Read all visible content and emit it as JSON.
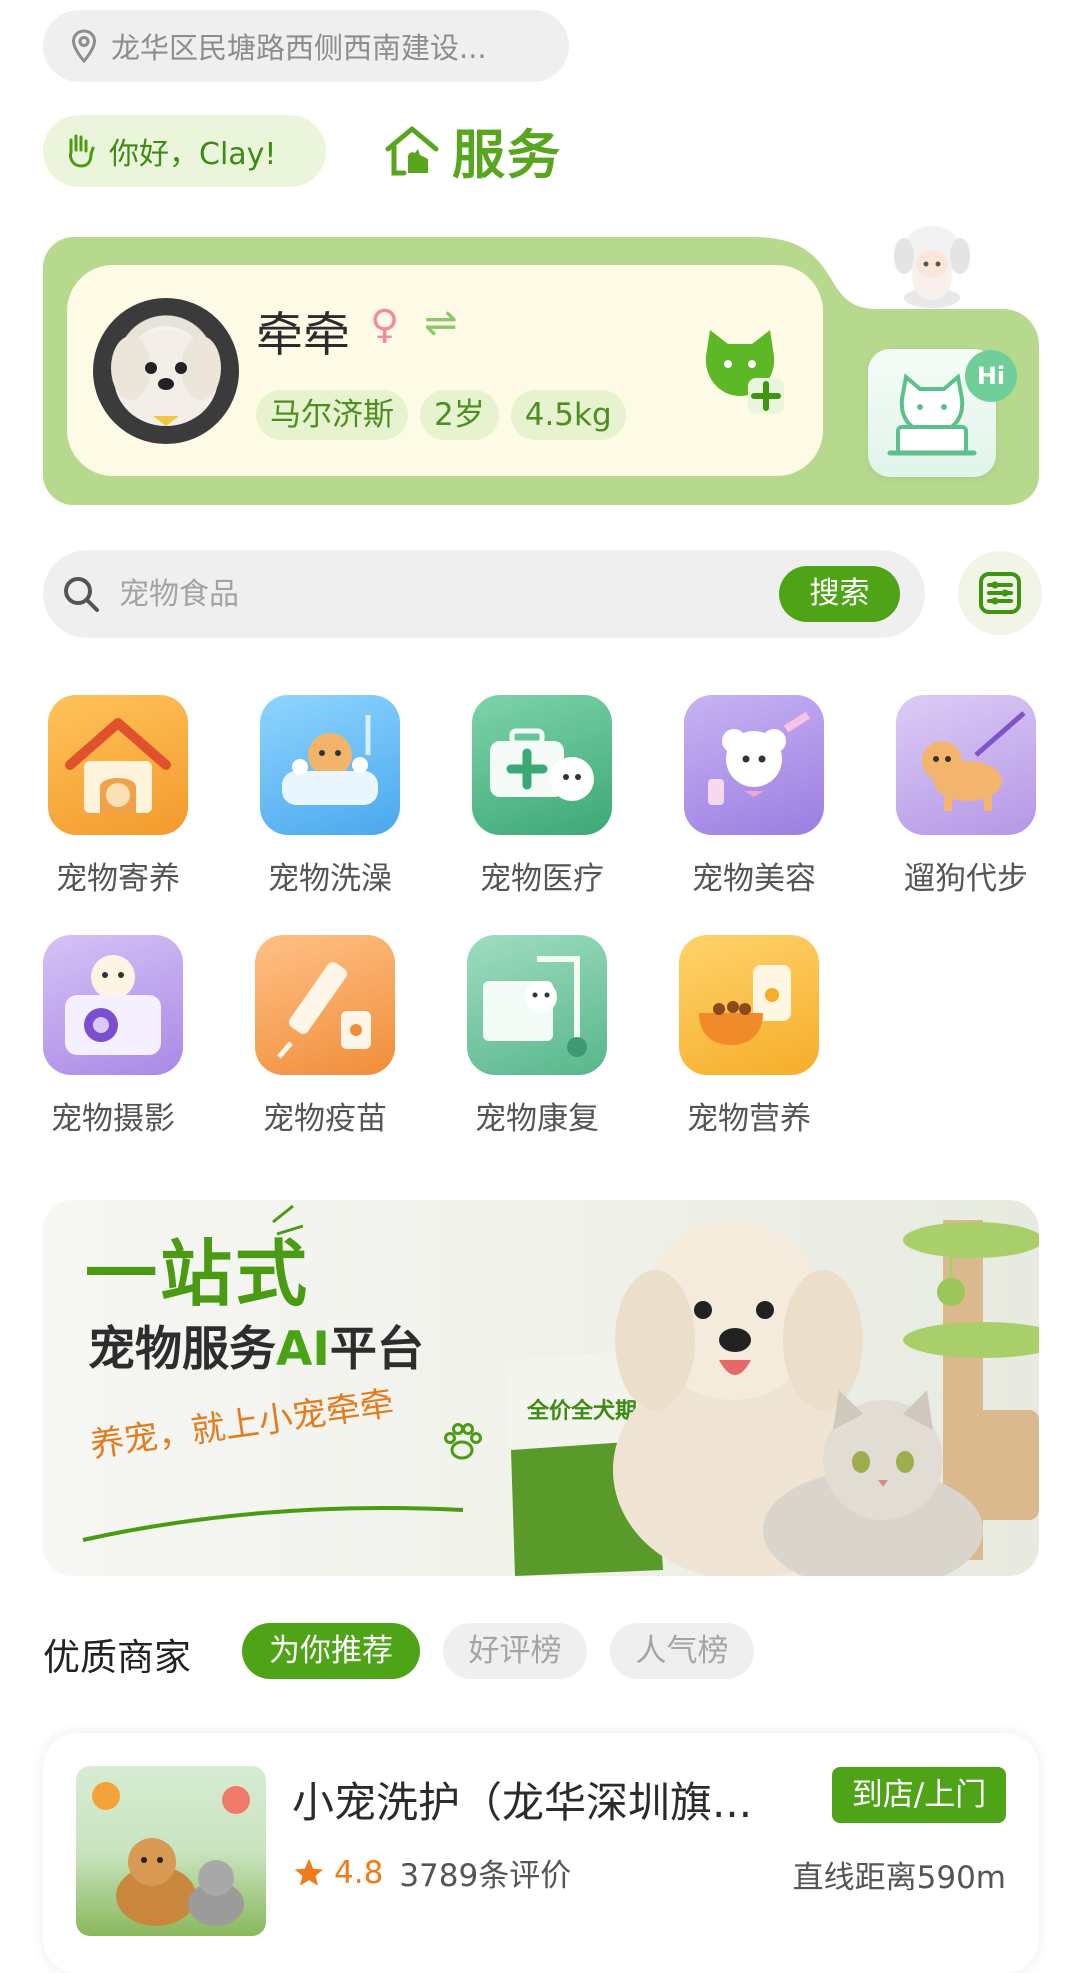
{
  "location": {
    "text": "龙华区民塘路西侧西南建设...",
    "icon": "location-pin-icon"
  },
  "greeting": {
    "text": "你好，Clay!",
    "icon": "waving-hand-icon"
  },
  "brand": {
    "title": "服务",
    "icon": "house-dog-icon"
  },
  "pet": {
    "name": "牵牵",
    "sex_symbol": "♀",
    "switch_symbol": "⇌",
    "tags": [
      "马尔济斯",
      "2岁",
      "4.5kg"
    ],
    "ai_badge": "Hi"
  },
  "search": {
    "placeholder": "宠物食品",
    "button": "搜索"
  },
  "categories": [
    {
      "label": "宠物寄养",
      "icon": "pet-house-icon",
      "color": "#f7a53a"
    },
    {
      "label": "宠物洗澡",
      "icon": "pet-bath-icon",
      "color": "#58b7ef"
    },
    {
      "label": "宠物医疗",
      "icon": "pet-medical-icon",
      "color": "#4fbb8b"
    },
    {
      "label": "宠物美容",
      "icon": "pet-grooming-icon",
      "color": "#a98ee2"
    },
    {
      "label": "遛狗代步",
      "icon": "dog-walking-icon",
      "color": "#c0a4e8"
    },
    {
      "label": "宠物摄影",
      "icon": "pet-camera-icon",
      "color": "#b99ae4"
    },
    {
      "label": "宠物疫苗",
      "icon": "pet-vaccine-icon",
      "color": "#f6a04f"
    },
    {
      "label": "宠物康复",
      "icon": "pet-rehab-icon",
      "color": "#6cc4a0"
    },
    {
      "label": "宠物营养",
      "icon": "pet-food-icon",
      "color": "#f8bd3e"
    }
  ],
  "banner": {
    "headline": "一站式",
    "subtitle_pre": "宠物服务",
    "subtitle_ai": "AI",
    "subtitle_post": "平台",
    "slogan": "养宠，就上小宠牵牵",
    "product_text": "全价全犬期犬粮"
  },
  "merchants": {
    "title": "优质商家",
    "tabs": [
      {
        "label": "为你推荐",
        "active": true
      },
      {
        "label": "好评榜",
        "active": false
      },
      {
        "label": "人气榜",
        "active": false
      }
    ],
    "items": [
      {
        "name": "小宠洗护（龙华深圳旗...",
        "badge": "到店/上门",
        "rating": "4.8",
        "reviews": "3789条评价",
        "distance": "直线距离590m"
      }
    ]
  },
  "colors": {
    "brand_green": "#4ea316",
    "card_green": "#b6d98e",
    "rating_orange": "#f07b1a"
  }
}
